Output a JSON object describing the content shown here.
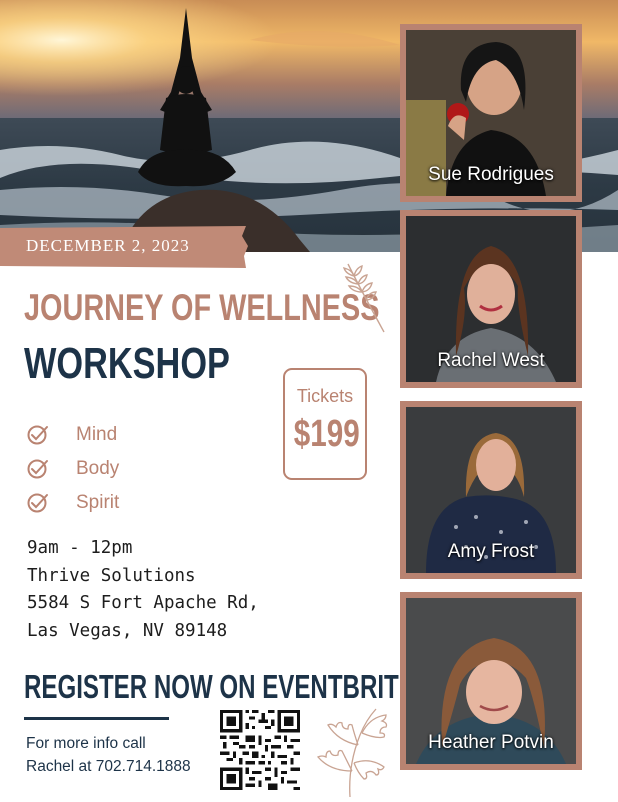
{
  "event": {
    "date": "DECEMBER 2, 2023",
    "title_line1": "JOURNEY OF WELLNESS",
    "title_line2": "WORKSHOP"
  },
  "tickets": {
    "label": "Tickets",
    "price": "$199"
  },
  "benefits": [
    "Mind",
    "Body",
    "Spirit"
  ],
  "details": {
    "time": "9am - 12pm",
    "venue": "Thrive Solutions",
    "address1": "5584 S Fort Apache Rd,",
    "address2": "Las Vegas, NV 89148"
  },
  "register": {
    "headline": "REGISTER NOW ON EVENTBRITE",
    "info_line1": "For more info call",
    "info_line2": "Rachel at 702.714.1888"
  },
  "speakers": [
    {
      "name": "Sue Rodrigues"
    },
    {
      "name": "Rachel West"
    },
    {
      "name": "Amy Frost"
    },
    {
      "name": "Heather Potvin"
    }
  ],
  "colors": {
    "accent": "#b98371",
    "navy": "#1d3348"
  },
  "icons": [
    "yoga-silhouette-icon",
    "wheat-icon",
    "checkmark-icon",
    "qr-code",
    "oak-leaves-icon"
  ]
}
